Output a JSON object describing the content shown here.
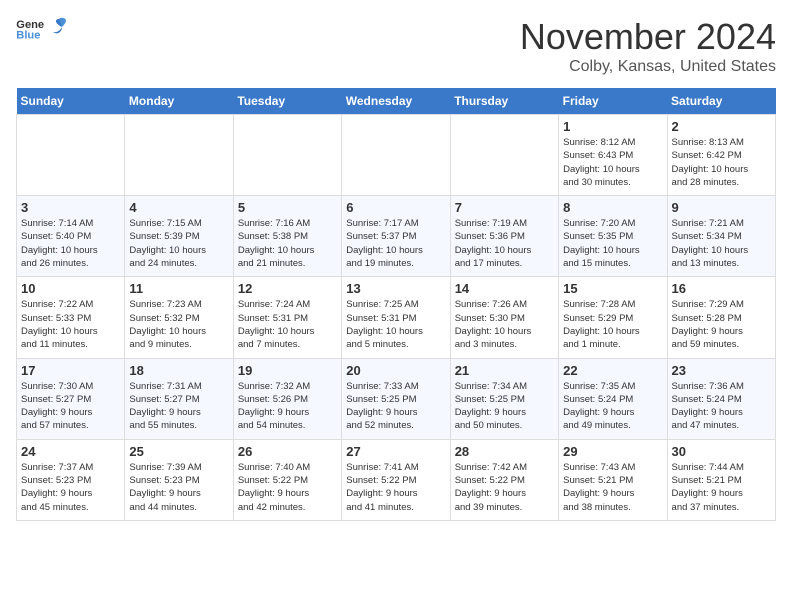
{
  "header": {
    "logo_general": "General",
    "logo_blue": "Blue",
    "month": "November 2024",
    "location": "Colby, Kansas, United States"
  },
  "weekdays": [
    "Sunday",
    "Monday",
    "Tuesday",
    "Wednesday",
    "Thursday",
    "Friday",
    "Saturday"
  ],
  "weeks": [
    [
      {
        "day": "",
        "info": ""
      },
      {
        "day": "",
        "info": ""
      },
      {
        "day": "",
        "info": ""
      },
      {
        "day": "",
        "info": ""
      },
      {
        "day": "",
        "info": ""
      },
      {
        "day": "1",
        "info": "Sunrise: 8:12 AM\nSunset: 6:43 PM\nDaylight: 10 hours\nand 30 minutes."
      },
      {
        "day": "2",
        "info": "Sunrise: 8:13 AM\nSunset: 6:42 PM\nDaylight: 10 hours\nand 28 minutes."
      }
    ],
    [
      {
        "day": "3",
        "info": "Sunrise: 7:14 AM\nSunset: 5:40 PM\nDaylight: 10 hours\nand 26 minutes."
      },
      {
        "day": "4",
        "info": "Sunrise: 7:15 AM\nSunset: 5:39 PM\nDaylight: 10 hours\nand 24 minutes."
      },
      {
        "day": "5",
        "info": "Sunrise: 7:16 AM\nSunset: 5:38 PM\nDaylight: 10 hours\nand 21 minutes."
      },
      {
        "day": "6",
        "info": "Sunrise: 7:17 AM\nSunset: 5:37 PM\nDaylight: 10 hours\nand 19 minutes."
      },
      {
        "day": "7",
        "info": "Sunrise: 7:19 AM\nSunset: 5:36 PM\nDaylight: 10 hours\nand 17 minutes."
      },
      {
        "day": "8",
        "info": "Sunrise: 7:20 AM\nSunset: 5:35 PM\nDaylight: 10 hours\nand 15 minutes."
      },
      {
        "day": "9",
        "info": "Sunrise: 7:21 AM\nSunset: 5:34 PM\nDaylight: 10 hours\nand 13 minutes."
      }
    ],
    [
      {
        "day": "10",
        "info": "Sunrise: 7:22 AM\nSunset: 5:33 PM\nDaylight: 10 hours\nand 11 minutes."
      },
      {
        "day": "11",
        "info": "Sunrise: 7:23 AM\nSunset: 5:32 PM\nDaylight: 10 hours\nand 9 minutes."
      },
      {
        "day": "12",
        "info": "Sunrise: 7:24 AM\nSunset: 5:31 PM\nDaylight: 10 hours\nand 7 minutes."
      },
      {
        "day": "13",
        "info": "Sunrise: 7:25 AM\nSunset: 5:31 PM\nDaylight: 10 hours\nand 5 minutes."
      },
      {
        "day": "14",
        "info": "Sunrise: 7:26 AM\nSunset: 5:30 PM\nDaylight: 10 hours\nand 3 minutes."
      },
      {
        "day": "15",
        "info": "Sunrise: 7:28 AM\nSunset: 5:29 PM\nDaylight: 10 hours\nand 1 minute."
      },
      {
        "day": "16",
        "info": "Sunrise: 7:29 AM\nSunset: 5:28 PM\nDaylight: 9 hours\nand 59 minutes."
      }
    ],
    [
      {
        "day": "17",
        "info": "Sunrise: 7:30 AM\nSunset: 5:27 PM\nDaylight: 9 hours\nand 57 minutes."
      },
      {
        "day": "18",
        "info": "Sunrise: 7:31 AM\nSunset: 5:27 PM\nDaylight: 9 hours\nand 55 minutes."
      },
      {
        "day": "19",
        "info": "Sunrise: 7:32 AM\nSunset: 5:26 PM\nDaylight: 9 hours\nand 54 minutes."
      },
      {
        "day": "20",
        "info": "Sunrise: 7:33 AM\nSunset: 5:25 PM\nDaylight: 9 hours\nand 52 minutes."
      },
      {
        "day": "21",
        "info": "Sunrise: 7:34 AM\nSunset: 5:25 PM\nDaylight: 9 hours\nand 50 minutes."
      },
      {
        "day": "22",
        "info": "Sunrise: 7:35 AM\nSunset: 5:24 PM\nDaylight: 9 hours\nand 49 minutes."
      },
      {
        "day": "23",
        "info": "Sunrise: 7:36 AM\nSunset: 5:24 PM\nDaylight: 9 hours\nand 47 minutes."
      }
    ],
    [
      {
        "day": "24",
        "info": "Sunrise: 7:37 AM\nSunset: 5:23 PM\nDaylight: 9 hours\nand 45 minutes."
      },
      {
        "day": "25",
        "info": "Sunrise: 7:39 AM\nSunset: 5:23 PM\nDaylight: 9 hours\nand 44 minutes."
      },
      {
        "day": "26",
        "info": "Sunrise: 7:40 AM\nSunset: 5:22 PM\nDaylight: 9 hours\nand 42 minutes."
      },
      {
        "day": "27",
        "info": "Sunrise: 7:41 AM\nSunset: 5:22 PM\nDaylight: 9 hours\nand 41 minutes."
      },
      {
        "day": "28",
        "info": "Sunrise: 7:42 AM\nSunset: 5:22 PM\nDaylight: 9 hours\nand 39 minutes."
      },
      {
        "day": "29",
        "info": "Sunrise: 7:43 AM\nSunset: 5:21 PM\nDaylight: 9 hours\nand 38 minutes."
      },
      {
        "day": "30",
        "info": "Sunrise: 7:44 AM\nSunset: 5:21 PM\nDaylight: 9 hours\nand 37 minutes."
      }
    ]
  ]
}
